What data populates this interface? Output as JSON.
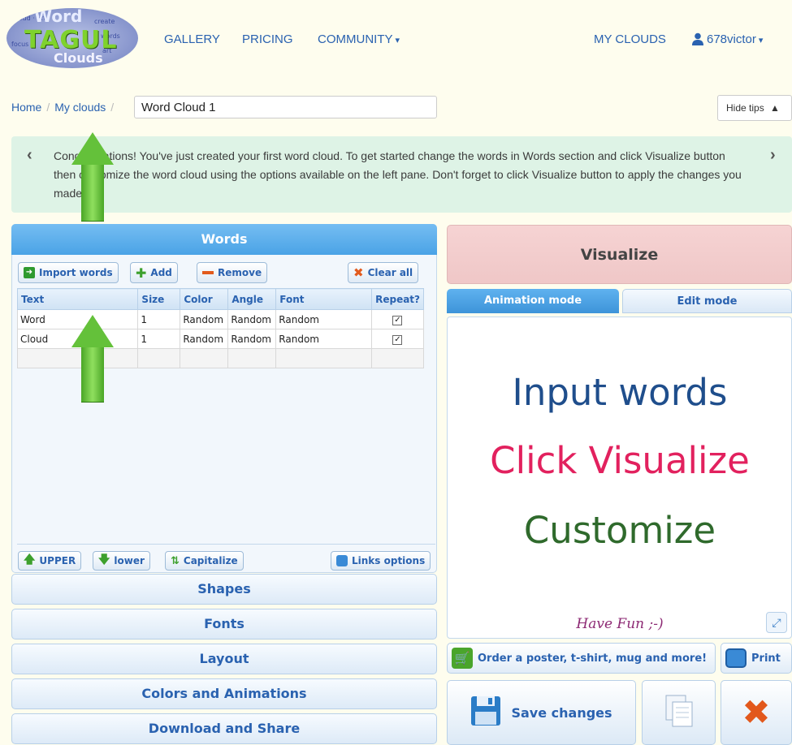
{
  "nav": {
    "logo_words": {
      "big": "TAGUL",
      "top": "Word",
      "bottom": "Clouds"
    },
    "gallery": "GALLERY",
    "pricing": "PRICING",
    "community": "COMMUNITY",
    "my_clouds": "MY CLOUDS",
    "user": "678victor"
  },
  "breadcrumb": {
    "home": "Home",
    "my_clouds": "My clouds",
    "cloud_name": "Word Cloud 1"
  },
  "hide_tips": "Hide tips",
  "tip": {
    "text": "Congratulations! You've just created your first word cloud. To get started change the words in Words section and click Visualize button then customize the word cloud using the options available on the left pane. Don't forget to click Visualize button to apply the changes you made."
  },
  "words": {
    "title": "Words",
    "import": "Import words",
    "add": "Add",
    "remove": "Remove",
    "clear": "Clear all",
    "columns": [
      "Text",
      "Size",
      "Color",
      "Angle",
      "Font",
      "Repeat?"
    ],
    "rows": [
      {
        "text": "Word",
        "size": "1",
        "color": "Random",
        "angle": "Random",
        "font": "Random",
        "repeat": true
      },
      {
        "text": "Cloud",
        "size": "1",
        "color": "Random",
        "angle": "Random",
        "font": "Random",
        "repeat": true
      }
    ],
    "upper": "UPPER",
    "lower": "lower",
    "capitalize": "Capitalize",
    "links": "Links options"
  },
  "sections": {
    "shapes": "Shapes",
    "fonts": "Fonts",
    "layout": "Layout",
    "colors": "Colors and Animations",
    "download": "Download and Share"
  },
  "right": {
    "visualize": "Visualize",
    "animation_mode": "Animation mode",
    "edit_mode": "Edit mode",
    "line1": "Input words",
    "line2": "Click Visualize",
    "line3": "Customize",
    "have_fun": "Have Fun ;-)",
    "order": "Order a poster, t-shirt, mug and more!",
    "print": "Print",
    "save": "Save changes"
  },
  "colors": {
    "line1": "#1f4e8c",
    "line2": "#e2215e",
    "line3": "#2f6a2c",
    "accent": "#2a62b0"
  }
}
